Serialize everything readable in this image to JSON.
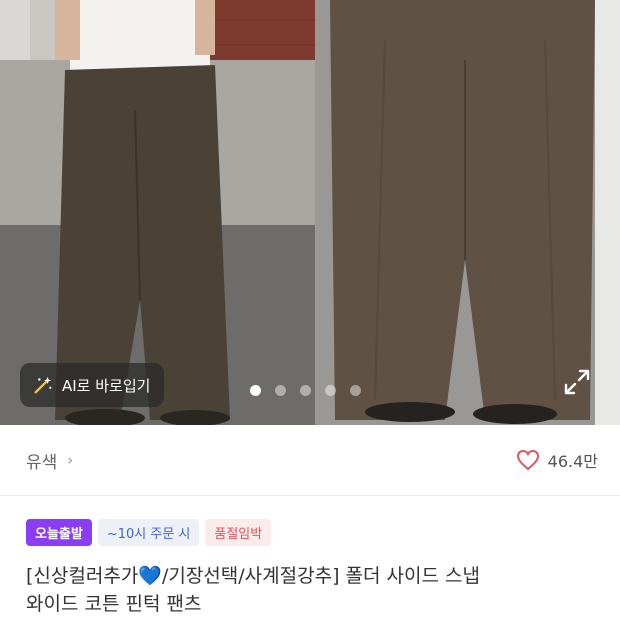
{
  "gallery": {
    "ai_button_label": "AI로 바로입기",
    "page_count": 5,
    "active_page": 1
  },
  "product": {
    "color_label": "유색",
    "color_chevron": "›",
    "like_count": "46.4만",
    "badges": [
      "오늘출발",
      "~10시 주문 시",
      "품절임박"
    ],
    "title_line1": "[신상컬러추가💙/기장선택/사계절강추] 폴더 사이드 스냅",
    "title_line2": "와이드 코튼 핀턱 팬츠"
  },
  "colors": {
    "accent_purple": "#8b3df5",
    "heart_red": "#e05560",
    "badge_blue": "#3d63d6"
  },
  "icons": [
    "magic-wand-icon",
    "expand-icon",
    "heart-icon",
    "chevron-right-icon"
  ]
}
